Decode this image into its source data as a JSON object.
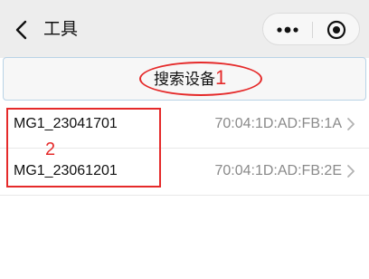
{
  "nav": {
    "title": "工具",
    "back_icon": "chevron-left-icon",
    "more_icon": "more-dots-icon",
    "close_icon": "target-circle-icon"
  },
  "search": {
    "label": "搜索设备"
  },
  "annotations": {
    "marker_1": "1",
    "marker_2": "2",
    "color": "#e52a2a"
  },
  "devices": [
    {
      "name": "MG1_23041701",
      "mac": "70:04:1D:AD:FB:1A"
    },
    {
      "name": "MG1_23061201",
      "mac": "70:04:1D:AD:FB:2E"
    }
  ],
  "colors": {
    "nav_bg": "#ededed",
    "button_border": "#b9d3e6",
    "mac_text": "#8a8a8a"
  }
}
